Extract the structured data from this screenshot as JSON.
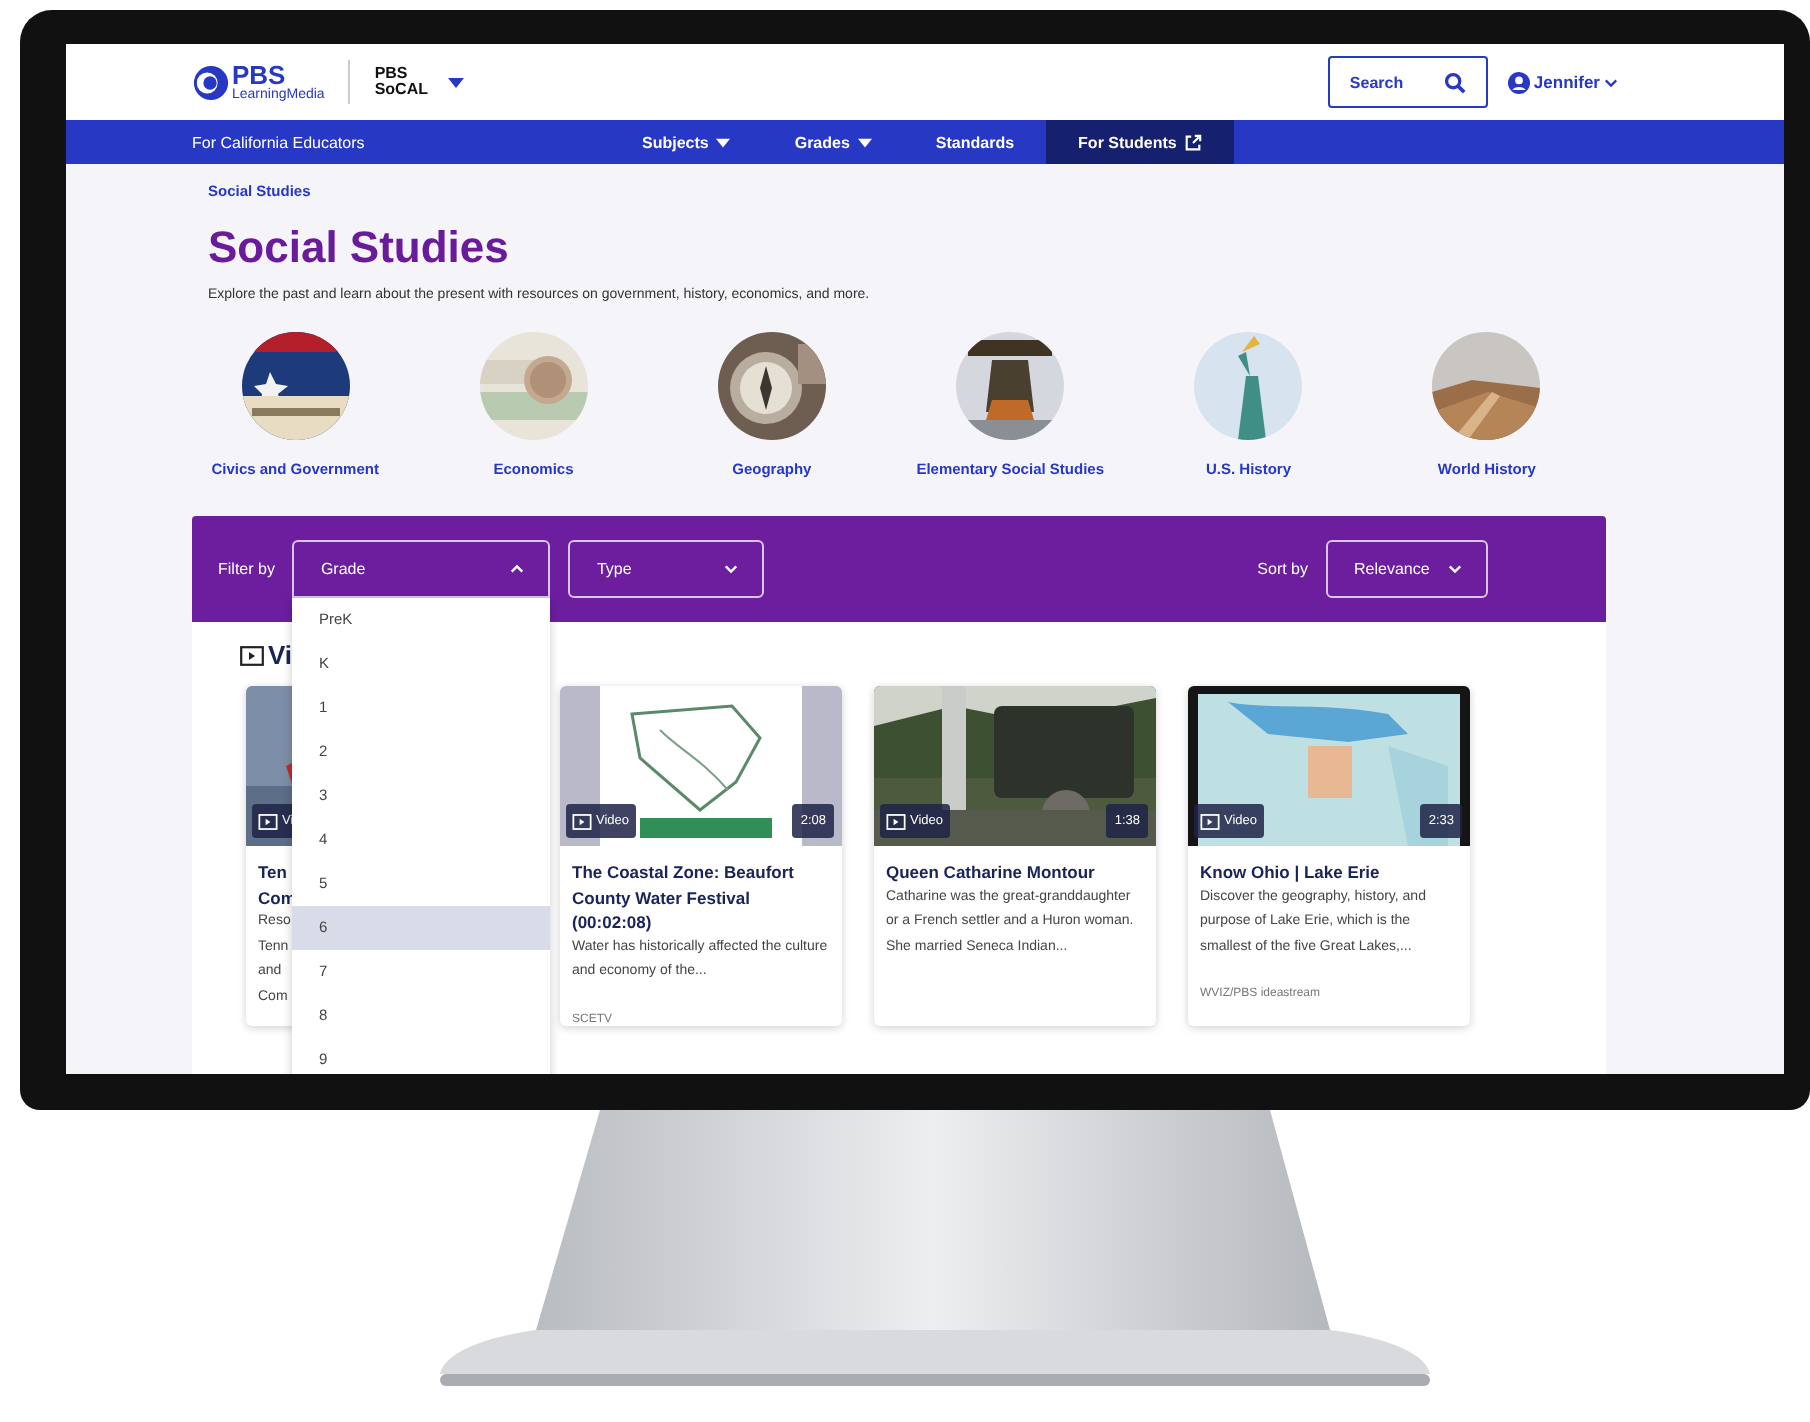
{
  "header": {
    "logo_primary": "PBS",
    "logo_secondary": "LearningMedia",
    "partner_logo_top": "PBS",
    "partner_logo_bottom": "SoCAL",
    "search_button": "Search",
    "user": "Jennifer"
  },
  "nav": {
    "region": "For California Educators",
    "items": [
      {
        "label": "Subjects",
        "kind": "dropdown",
        "selected": false
      },
      {
        "label": "Grades",
        "kind": "dropdown",
        "selected": false
      },
      {
        "label": "Standards",
        "kind": "link",
        "selected": false
      },
      {
        "label": "For Students",
        "kind": "external",
        "selected": true
      }
    ]
  },
  "breadcrumb": "Social Studies",
  "title": "Social Studies",
  "description": "Explore the past and learn about the present with resources on government, history, economics, and more.",
  "topics": [
    {
      "label": "Civics and Government"
    },
    {
      "label": "Economics"
    },
    {
      "label": "Geography"
    },
    {
      "label": "Elementary Social Studies"
    },
    {
      "label": "U.S. History"
    },
    {
      "label": "World History"
    }
  ],
  "filter_bar": {
    "filter_label": "Filter by",
    "filters": [
      {
        "label": "Grade",
        "expanded": true
      },
      {
        "label": "Type",
        "expanded": false
      }
    ],
    "sort_label": "Sort by",
    "sort": "Relevance"
  },
  "grade_options": [
    {
      "label": "PreK",
      "selected": false
    },
    {
      "label": "K",
      "selected": false
    },
    {
      "label": "1",
      "selected": false
    },
    {
      "label": "2",
      "selected": false
    },
    {
      "label": "3",
      "selected": false
    },
    {
      "label": "4",
      "selected": false
    },
    {
      "label": "5",
      "selected": false
    },
    {
      "label": "6",
      "selected": true
    },
    {
      "label": "7",
      "selected": false
    },
    {
      "label": "8",
      "selected": false
    },
    {
      "label": "9",
      "selected": false
    }
  ],
  "section_heading": "Vi",
  "cards": [
    {
      "badge": "Vi",
      "title": "Ten\nCom",
      "description": "Reso\nTenn\nand\nCom"
    },
    {
      "badge": "Video",
      "duration": "2:08",
      "title": "The Coastal Zone: Beaufort County Water Festival (00:02:08)",
      "description": "Water has historically affected the culture and economy of the...",
      "source": "SCETV"
    },
    {
      "badge": "Video",
      "duration": "1:38",
      "title": "Queen Catharine Montour",
      "description": "Catharine was the great-granddaughter or a French settler and a Huron woman. She married Seneca Indian..."
    },
    {
      "badge": "Video",
      "duration": "2:33",
      "title": "Know Ohio | Lake Erie",
      "description": "Discover the geography, history, and purpose of Lake Erie, which is the smallest of the five Great Lakes,...",
      "source": "WVIZ/PBS ideastream"
    }
  ]
}
